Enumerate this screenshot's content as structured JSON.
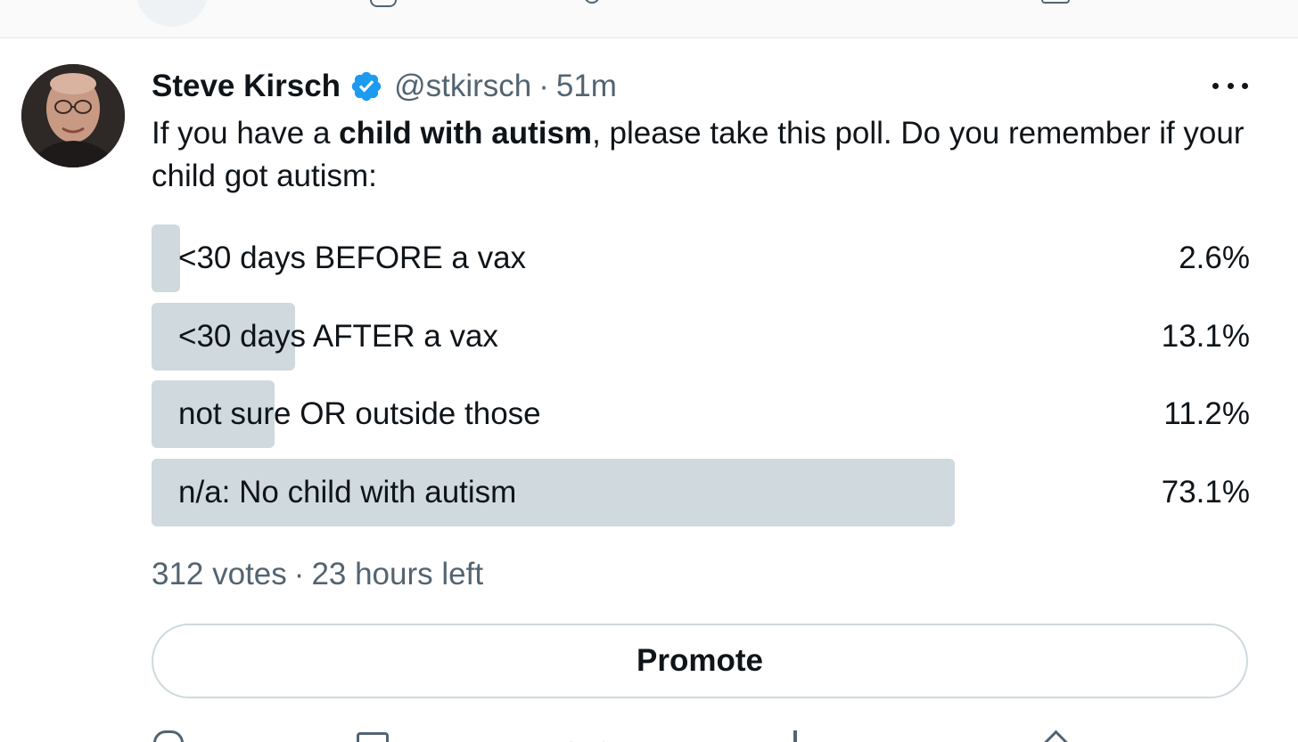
{
  "tweet": {
    "author_name": "Steve Kirsch",
    "handle": "@stkirsch",
    "separator": "·",
    "time": "51m",
    "text": {
      "part1": "If you have a ",
      "bold": "child with autism",
      "part2": ", please take this poll. Do you remember if your child got autism:"
    }
  },
  "poll": {
    "options": [
      {
        "label": "<30 days BEFORE a vax",
        "percent_text": "2.6%",
        "percent": 2.6
      },
      {
        "label": "<30 days AFTER a vax",
        "percent_text": "13.1%",
        "percent": 13.1
      },
      {
        "label": "not sure OR outside those",
        "percent_text": "11.2%",
        "percent": 11.2
      },
      {
        "label": "n/a: No child with autism",
        "percent_text": "73.1%",
        "percent": 73.1
      }
    ],
    "votes": "312 votes",
    "separator": "·",
    "time_left": "23 hours left"
  },
  "promote_label": "Promote",
  "icons": {
    "verified": "verified-badge-icon",
    "more": "more-options-icon",
    "reply": "reply-icon",
    "retweet": "retweet-icon",
    "like": "like-icon",
    "views": "views-icon",
    "share": "share-icon"
  },
  "colors": {
    "verified_blue": "#1d9bf0",
    "poll_fill": "#cfd9de",
    "secondary_text": "#536471",
    "primary_text": "#0f1419"
  }
}
